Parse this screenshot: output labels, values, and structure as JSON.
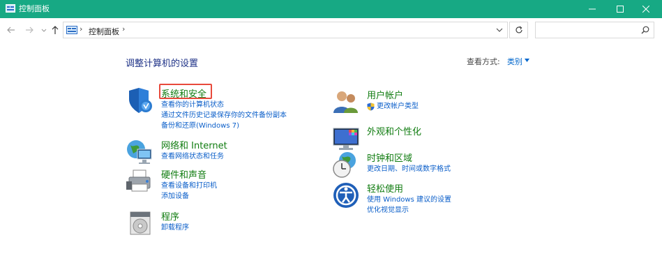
{
  "window": {
    "title": "控制面板"
  },
  "address": {
    "crumb": "控制面板",
    "separator": "›",
    "search_placeholder": ""
  },
  "content": {
    "page_title": "调整计算机的设置",
    "view_by_label": "查看方式:",
    "view_by_value": "类别"
  },
  "categories": {
    "security": {
      "title": "系统和安全",
      "links": [
        "查看你的计算机状态",
        "通过文件历史记录保存你的文件备份副本",
        "备份和还原(Windows 7)"
      ]
    },
    "network": {
      "title": "网络和 Internet",
      "links": [
        "查看网络状态和任务"
      ]
    },
    "hardware": {
      "title": "硬件和声音",
      "links": [
        "查看设备和打印机",
        "添加设备"
      ]
    },
    "programs": {
      "title": "程序",
      "links": [
        "卸载程序"
      ]
    },
    "accounts": {
      "title": "用户帐户",
      "links": [
        "更改帐户类型"
      ]
    },
    "appearance": {
      "title": "外观和个性化",
      "links": []
    },
    "clock": {
      "title": "时钟和区域",
      "links": [
        "更改日期、时间或数字格式"
      ]
    },
    "ease": {
      "title": "轻松使用",
      "links": [
        "使用 Windows 建议的设置",
        "优化视觉显示"
      ]
    }
  },
  "colors": {
    "titlebar": "#17a984",
    "category_title": "#107c10",
    "link": "#0a5ec9",
    "page_title": "#1e3287",
    "highlight": "#e84a3c"
  },
  "icons": {
    "back": "arrow-left-icon",
    "forward": "arrow-right-icon",
    "up": "arrow-up-icon",
    "refresh": "refresh-icon",
    "search": "search-icon"
  }
}
